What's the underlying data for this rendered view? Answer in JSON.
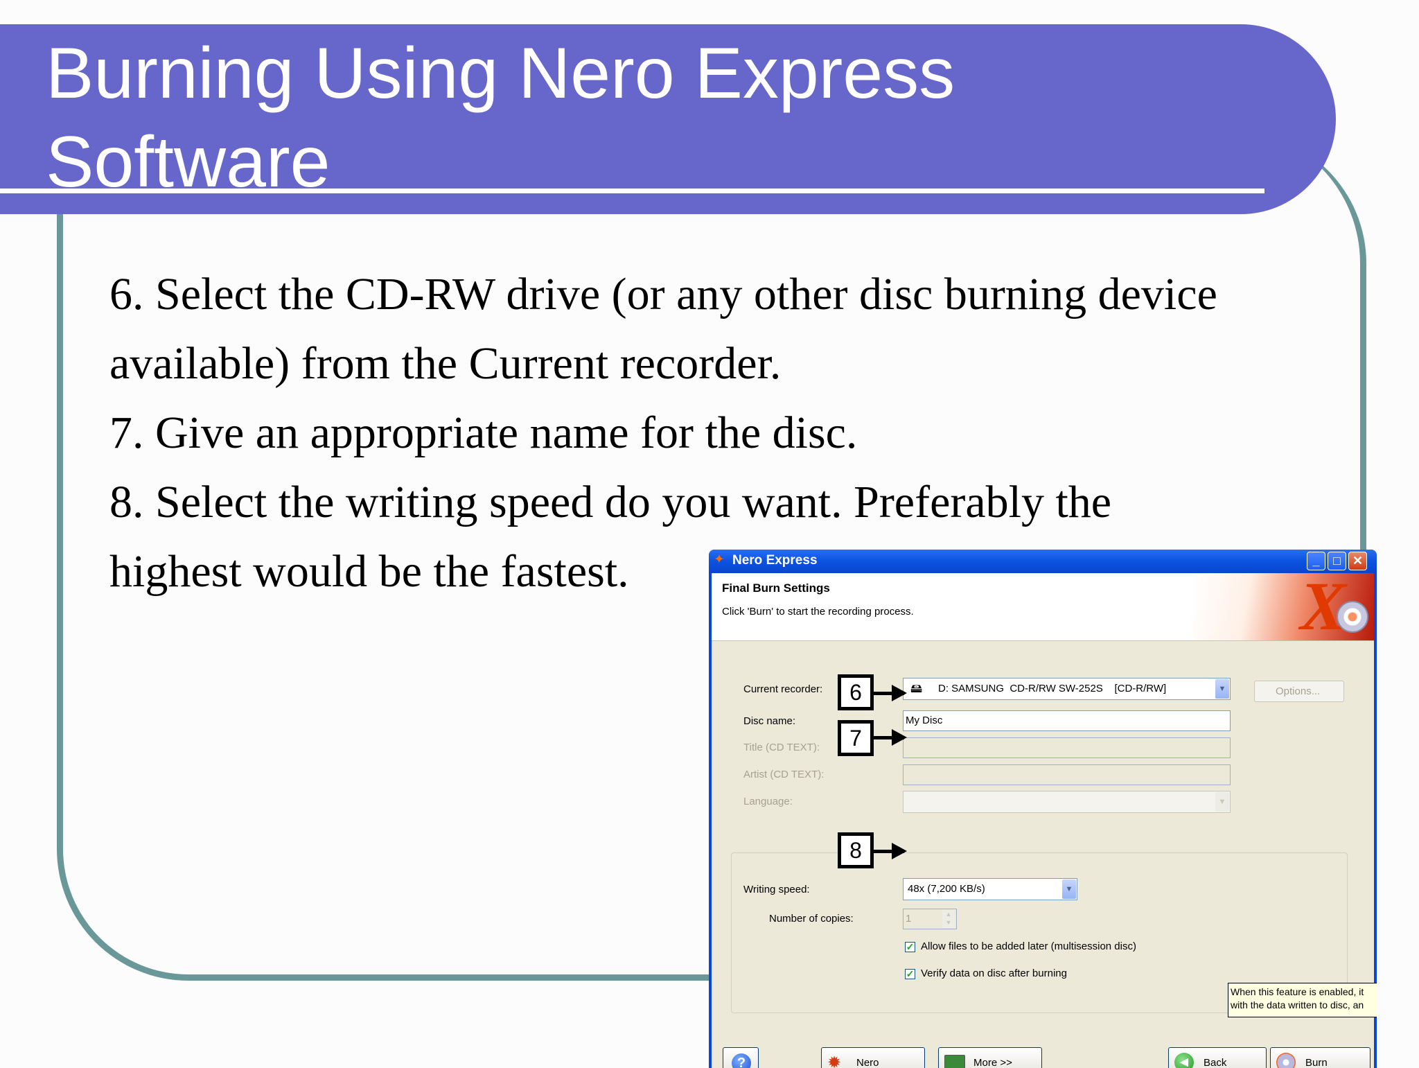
{
  "slide": {
    "title_line1": "Burning Using Nero Express",
    "title_line2": "Software",
    "steps": [
      "6. Select the CD-RW drive (or any other disc burning device available) from the Current recorder.",
      "7. Give an appropriate name for the disc.",
      "8. Select the writing speed do you want. Preferably the highest would be the fastest."
    ]
  },
  "window": {
    "title": "Nero Express",
    "controls": {
      "minimize": "_",
      "maximize": "□",
      "close": "✕"
    },
    "header": {
      "title": "Final Burn Settings",
      "subtitle": "Click 'Burn' to start the recording process."
    },
    "form": {
      "current_recorder_label": "Current recorder:",
      "current_recorder_value": "D: SAMSUNG  CD-R/RW SW-252S    [CD-R/RW]",
      "options_button": "Options...",
      "disc_name_label": "Disc name:",
      "disc_name_value": "My Disc",
      "title_label": "Title (CD TEXT):",
      "artist_label": "Artist (CD TEXT):",
      "language_label": "Language:",
      "writing_speed_label": "Writing speed:",
      "writing_speed_value": "48x (7,200 KB/s)",
      "copies_label": "Number of copies:",
      "copies_value": "1",
      "multisession_label": "Allow files to be added later (multisession disc)",
      "multisession_checked": true,
      "verify_label": "Verify data on disc after burning",
      "verify_checked": true
    },
    "tooltip": {
      "line1": "When this feature is enabled, it",
      "line2": "with the data written to disc, an"
    },
    "buttons": {
      "help": "?",
      "nero": "Nero",
      "more": "More >>",
      "back": "Back",
      "burn": "Burn"
    }
  },
  "callouts": {
    "step6": "6",
    "step7": "7",
    "step8": "8"
  },
  "colors": {
    "title_band": "#6767cb",
    "frame": "#6a9898",
    "xp_blue": "#0a46dc"
  }
}
